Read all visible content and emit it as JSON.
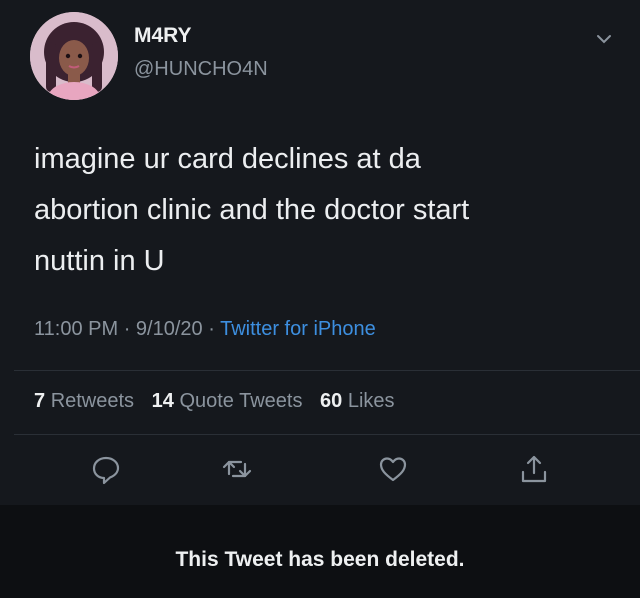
{
  "user": {
    "display_name": "M4RY",
    "handle": "@HUNCHO4N"
  },
  "tweet": {
    "text_lines": [
      "imagine ur card declines at da",
      "abortion clinic and the doctor start",
      "nuttin in U"
    ],
    "time": "11:00 PM",
    "date": "9/10/20",
    "separator": "·",
    "client": "Twitter for iPhone"
  },
  "stats": {
    "retweets_count": "7",
    "retweets_label": "Retweets",
    "quotes_count": "14",
    "quotes_label": "Quote Tweets",
    "likes_count": "60",
    "likes_label": "Likes"
  },
  "actions": [
    "reply-icon",
    "retweet-icon",
    "like-icon",
    "share-icon"
  ],
  "notice": "This Tweet has been deleted.",
  "colors": {
    "background": "#15181d",
    "link": "#3d8fe0",
    "muted": "#8b949e"
  }
}
